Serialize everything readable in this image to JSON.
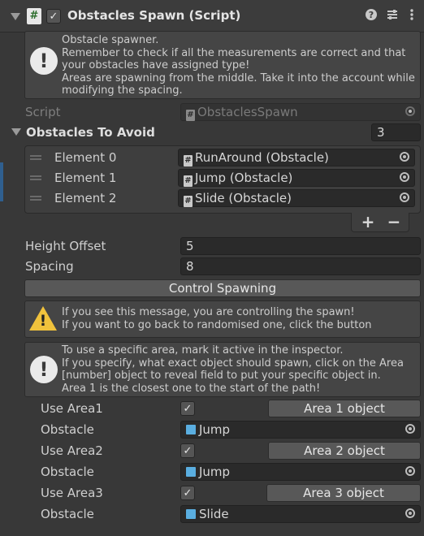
{
  "header": {
    "title": "Obstacles Spawn (Script)",
    "enabled_check": "✓",
    "icons": [
      "help-icon",
      "presets-icon",
      "more-icon"
    ]
  },
  "description_box": {
    "text": "Obstacle spawner.\nRemember to check if all the measurements are correct and that your obstacles have assigned type!\nAreas are spawning from the middle. Take it into the account while modifying the spacing."
  },
  "script_field": {
    "label": "Script",
    "value": "ObstaclesSpawn"
  },
  "obstacles_to_avoid": {
    "label": "Obstacles To Avoid",
    "size": "3",
    "elements": [
      {
        "label": "Element 0",
        "value": "RunAround (Obstacle)"
      },
      {
        "label": "Element 1",
        "value": "Jump (Obstacle)"
      },
      {
        "label": "Element 2",
        "value": "Slide (Obstacle)"
      }
    ],
    "add_label": "+",
    "remove_label": "−"
  },
  "height_offset": {
    "label": "Height Offset",
    "value": "5"
  },
  "spacing": {
    "label": "Spacing",
    "value": "8"
  },
  "control_spawning_button": "Control Spawning",
  "warning_box": {
    "text": "If you see this message, you are controlling the spawn!\nIf you want to go back to randomised one, click the button"
  },
  "area_info_box": {
    "text": "To use a specific area, mark it active in the inspector.\nIf you specify, what exact object should spawn, click on the Area [number] object to reveal field to put your specific object in.\nArea 1 is the closest one to the start of the path!"
  },
  "areas": [
    {
      "use_label": "Use Area1",
      "checked": "✓",
      "button": "Area 1 object",
      "obstacle_label": "Obstacle",
      "obstacle_value": "Jump"
    },
    {
      "use_label": "Use Area2",
      "checked": "✓",
      "button": "Area 2 object",
      "obstacle_label": "Obstacle",
      "obstacle_value": "Jump"
    },
    {
      "use_label": "Use Area3",
      "checked": "✓",
      "button": "Area 3 object",
      "obstacle_label": "Obstacle",
      "obstacle_value": "Slide"
    }
  ]
}
